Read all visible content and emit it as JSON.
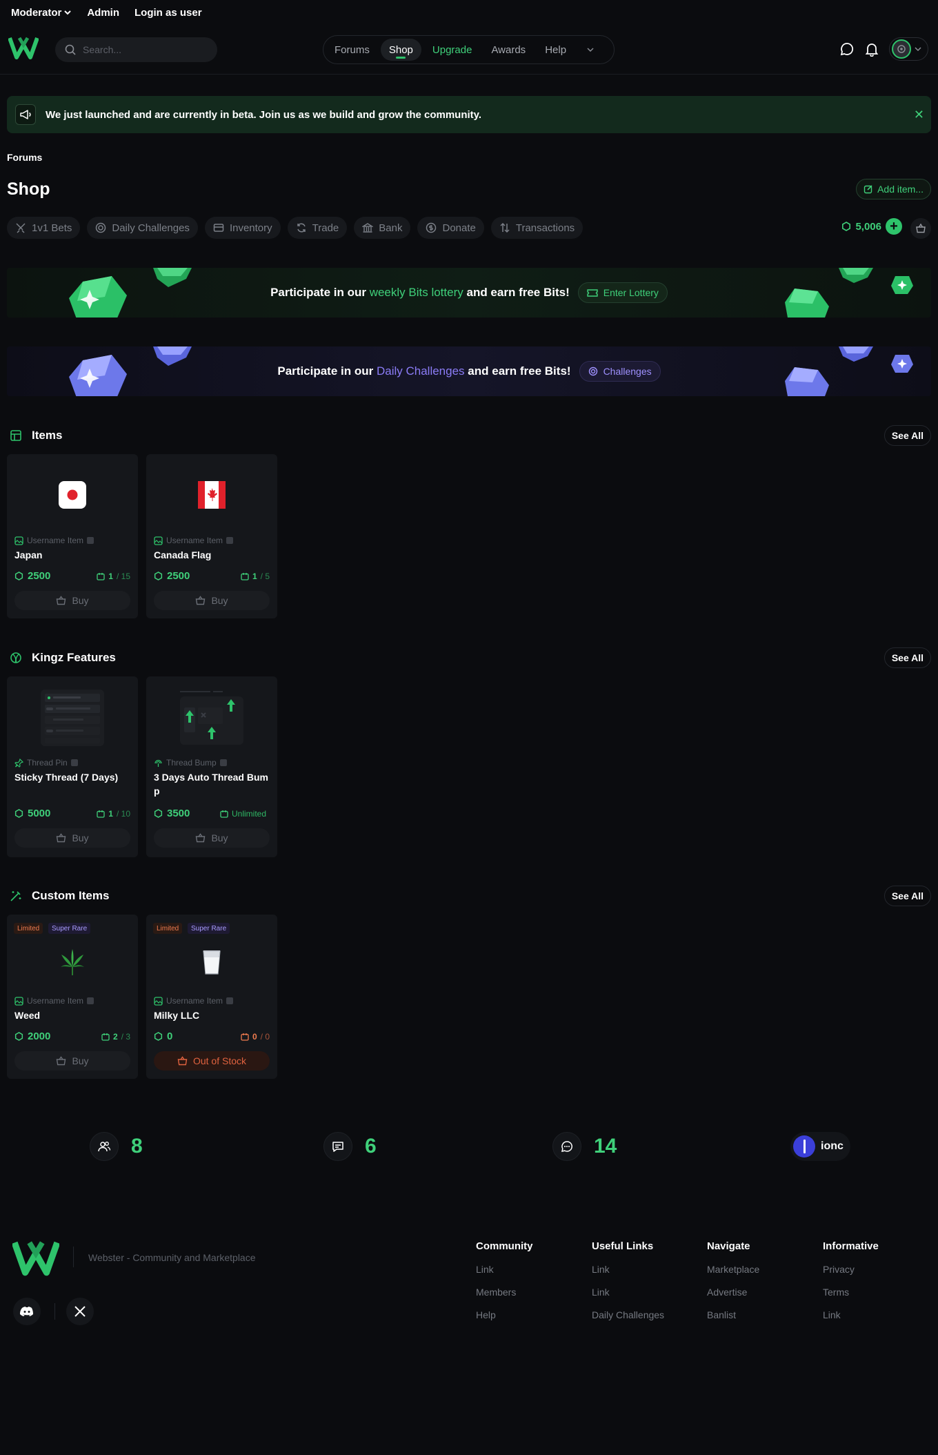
{
  "admin_bar": {
    "moderator": "Moderator",
    "admin": "Admin",
    "login_as_user": "Login as user"
  },
  "header": {
    "search_placeholder": "Search...",
    "nav": [
      "Forums",
      "Shop",
      "Upgrade",
      "Awards",
      "Help"
    ],
    "active_nav": "Shop"
  },
  "beta_banner": {
    "text": "We just launched and are currently in beta. Join us as we build and grow the community."
  },
  "breadcrumb": "Forums",
  "page_title": "Shop",
  "add_item_label": "Add item...",
  "tabs": [
    "1v1 Bets",
    "Daily Challenges",
    "Inventory",
    "Trade",
    "Bank",
    "Donate",
    "Transactions"
  ],
  "balance": "5,006",
  "promos": {
    "lottery": {
      "pre": "Participate in our",
      "highlight": "weekly Bits lottery",
      "post": "and earn free Bits!",
      "button": "Enter Lottery"
    },
    "challenges": {
      "pre": "Participate in our",
      "highlight": "Daily Challenges",
      "post": "and earn free Bits!",
      "button": "Challenges"
    }
  },
  "sections": {
    "items": {
      "title": "Items",
      "see_all": "See All",
      "cards": [
        {
          "type": "Username Item",
          "name": "Japan",
          "price": "2500",
          "stock": "1",
          "total": "/ 15",
          "button": "Buy"
        },
        {
          "type": "Username Item",
          "name": "Canada Flag",
          "price": "2500",
          "stock": "1",
          "total": "/ 5",
          "button": "Buy"
        }
      ]
    },
    "features": {
      "title": "Kingz Features",
      "see_all": "See All",
      "cards": [
        {
          "type": "Thread Pin",
          "name": "Sticky Thread (7 Days)",
          "price": "5000",
          "stock": "1",
          "total": "/ 10",
          "button": "Buy"
        },
        {
          "type": "Thread Bump",
          "name": "3 Days Auto Thread Bum p",
          "price": "3500",
          "stock": "Unlimited",
          "total": "",
          "button": "Buy"
        }
      ]
    },
    "custom": {
      "title": "Custom Items",
      "see_all": "See All",
      "cards": [
        {
          "badges": [
            "Limited",
            "Super Rare"
          ],
          "type": "Username Item",
          "name": "Weed",
          "price": "2000",
          "stock": "2",
          "total": "/ 3",
          "button": "Buy"
        },
        {
          "badges": [
            "Limited",
            "Super Rare"
          ],
          "type": "Username Item",
          "name": "Milky LLC",
          "price": "0",
          "stock": "0",
          "total": "/ 0",
          "button": "Out of Stock"
        }
      ]
    }
  },
  "stats": {
    "members": "8",
    "threads": "6",
    "posts": "14",
    "newest_member": "ionc"
  },
  "footer": {
    "tagline": "Webster - Community and Marketplace",
    "columns": [
      {
        "heading": "Community",
        "links": [
          "Link",
          "Members",
          "Help"
        ]
      },
      {
        "heading": "Useful Links",
        "links": [
          "Link",
          "Link",
          "Daily Challenges"
        ]
      },
      {
        "heading": "Navigate",
        "links": [
          "Marketplace",
          "Advertise",
          "Banlist"
        ]
      },
      {
        "heading": "Informative",
        "links": [
          "Privacy",
          "Terms",
          "Link"
        ]
      }
    ]
  },
  "colors": {
    "accent": "#2ec36b",
    "accent_text": "#3fd07a",
    "purple": "#8b7cf6",
    "background": "#0b0c0f",
    "out_of_stock": "#e0623f"
  },
  "icons": [
    "megaphone-icon",
    "search-icon",
    "chat-icon",
    "bell-icon",
    "cart-icon",
    "coin-icon",
    "users-icon",
    "message-icon"
  ]
}
